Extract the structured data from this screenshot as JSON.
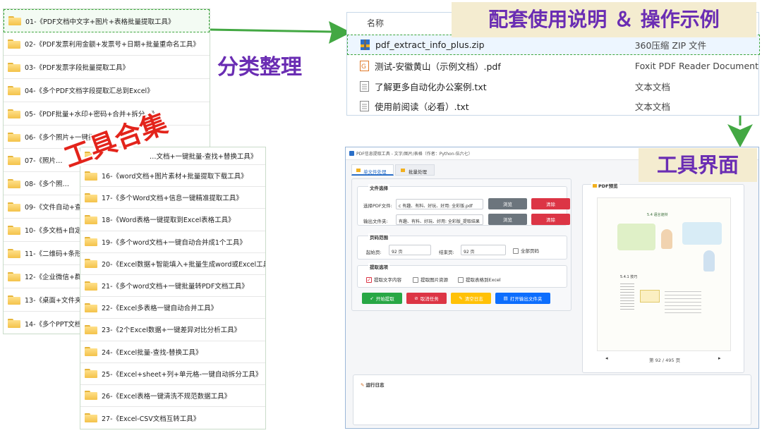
{
  "left_list": {
    "items": [
      "01-《PDF文档中文字+图片+表格批量提取工具》",
      "02-《PDF发票利用金额+发票号+日期+批量重命名工具》",
      "03-《PDF发票字段批量提取工具》",
      "04-《多个PDF文档字段提取汇总到Excel》",
      "05-《PDF批量+水印+密码+合并+拆分…》",
      "06-《多个照片+一键批…",
      "07-《照片…",
      "08-《多个照…",
      "09-《文件自动+查…",
      "10-《多文档+自定…",
      "11-《二维码+条形…",
      "12-《企业微信+群…",
      "13-《桌面+文件夹…",
      "14-《多个PPT文档…"
    ]
  },
  "right_list": {
    "first_partial": "…文档+一键批量-查找+替换工具》",
    "items": [
      "16-《word文档+图片素材+批量提取下载工具》",
      "17-《多个Word文档+信息一键精准提取工具》",
      "18-《Word表格一键提取到Excel表格工具》",
      "19-《多个word文档+一键自动合并成1个工具》",
      "20-《Excel数据+智能填入+批量生成word或Excel工具》",
      "21-《多个word文档+一键批量转PDF文档工具》",
      "22-《Excel多表格一键自动合并工具》",
      "23-《2个Excel数据+一键差异对比分析工具》",
      "24-《Excel批量-查找-替换工具》",
      "25-《Excel+sheet+列+单元格-一键自动拆分工具》",
      "26-《Excel表格一键清洗不规范数据工具》",
      "27-《Excel-CSV文档互转工具》"
    ]
  },
  "labels": {
    "classify": "分类整理",
    "tools_collection": "工具合集",
    "instructions": "配套使用说明 ＆ 操作示例",
    "tool_ui": "工具界面"
  },
  "files": {
    "header_name": "名称",
    "rows": [
      {
        "name": "pdf_extract_info_plus.zip",
        "type": "360压缩 ZIP 文件",
        "icon": "zip-icon"
      },
      {
        "name": "测试-安徽黄山（示例文档）.pdf",
        "type": "Foxit PDF Reader Document",
        "icon": "pdf-icon"
      },
      {
        "name": "了解更多自动化办公案例.txt",
        "type": "文本文档",
        "icon": "txt-icon"
      },
      {
        "name": "使用前阅读（必看）.txt",
        "type": "文本文档",
        "icon": "txt-icon"
      }
    ]
  },
  "tool": {
    "title": "PDF信息提取工具 - 文字/图片/表格（作者：Python-伍六七）",
    "tabs": [
      "单文件处理",
      "批量处理"
    ],
    "file_section": "文件选择",
    "pdf_label": "选择PDF文件:",
    "pdf_value": "c 有趣、有料、好玩、好用: 全彩版.pdf",
    "out_label": "输出文件夹:",
    "out_value": "有趣、有料、好玩、好用: 全彩版_提取结果",
    "browse": "浏览",
    "clear": "清除",
    "page_section": "页码范围",
    "start_label": "起始页:",
    "start_value": "92 页",
    "end_label": "结束页:",
    "end_value": "92 页",
    "all_pages": "全部页码",
    "options_section": "提取选项",
    "opt_text": "提取文字内容",
    "opt_images": "提取图片资源",
    "opt_tables": "提取表格到Excel",
    "btn_start": "开始提取",
    "btn_cancel": "取消任务",
    "btn_clear_log": "清空日志",
    "btn_open": "打开输出文件夹",
    "preview_section": "PDF预览",
    "page_indicator": "第 92 / 495 页",
    "log_section": "运行日志",
    "preview_heading": "5.4 语言诡辩",
    "preview_sub": "5.4.1 技巧"
  },
  "colors": {
    "green_arrow": "#43a843",
    "purple_text": "#6a2db3",
    "red_text": "#e3241b",
    "banner_bg": "#f4ecd0"
  }
}
